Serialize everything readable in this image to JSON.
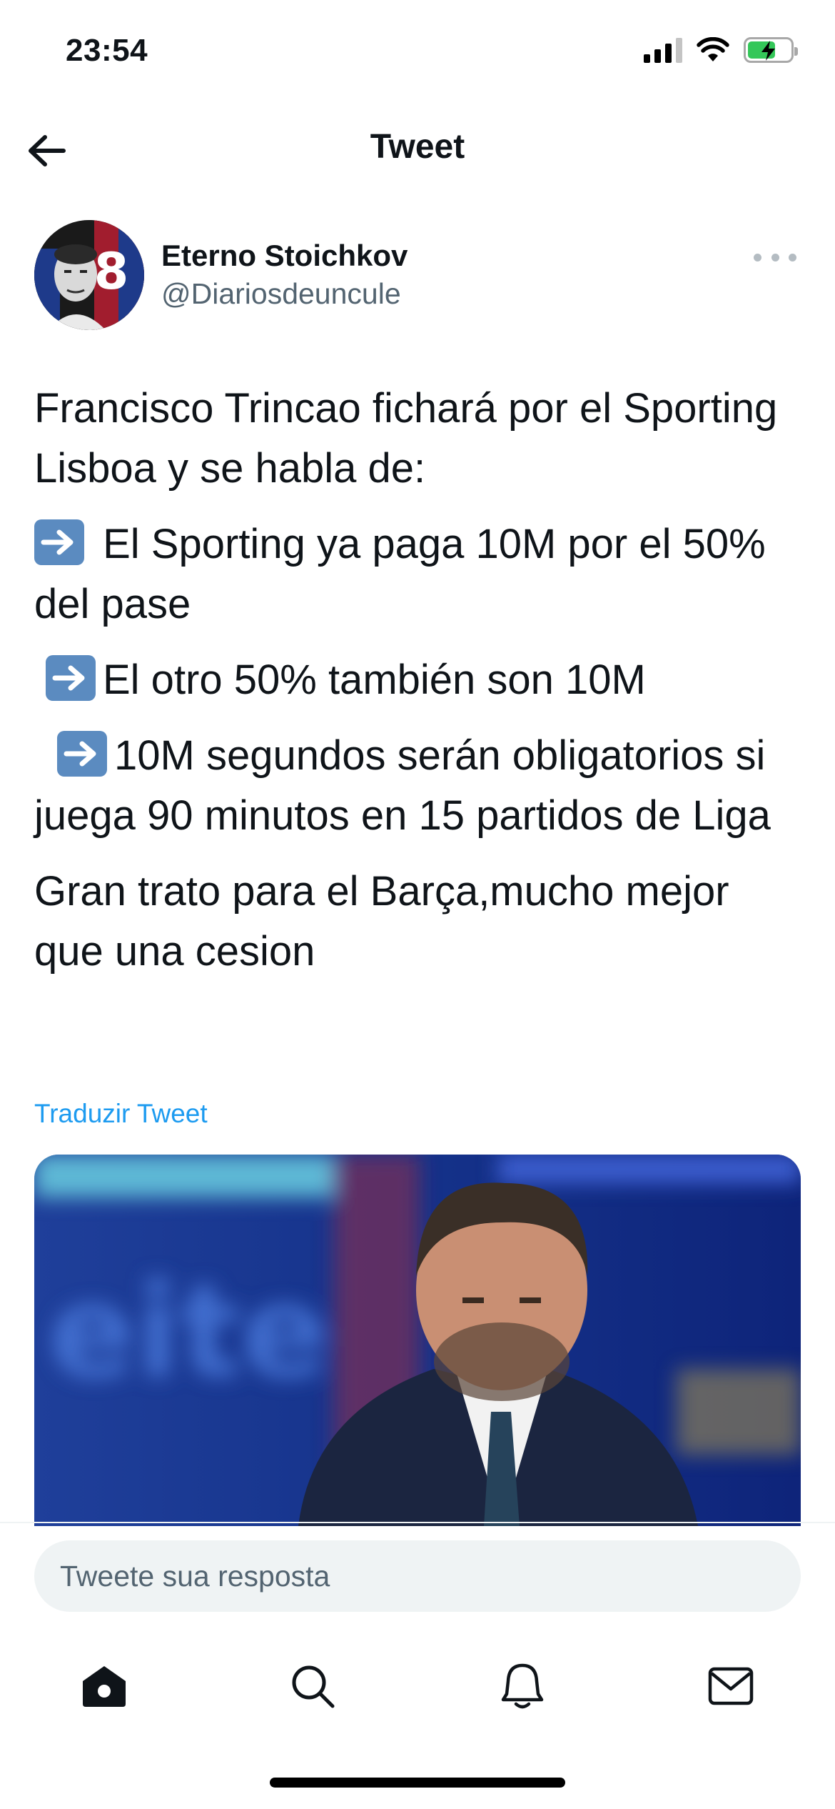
{
  "status_bar": {
    "time": "23:54",
    "icons": [
      "signal-icon",
      "wifi-icon",
      "battery-charging-icon"
    ]
  },
  "header": {
    "title": "Tweet",
    "back_icon": "arrow-left-icon"
  },
  "tweet": {
    "author_name": "Eterno Stoichkov",
    "author_handle": "@Diariosdeuncule",
    "more_icon": "more-dots-icon",
    "paragraphs": [
      "Francisco Trincao fichará por el Sporting Lisboa y se habla de:",
      " El Sporting ya paga 10M por el 50% del pase",
      "El otro 50% también son 10M",
      "10M segundos serán obligatorios si  juega 90 minutos en 15 partidos de Liga",
      "Gran trato para el Barça,mucho mejor que una cesion"
    ],
    "translate_label": "Traduzir Tweet",
    "link_color": "#1d9bf0"
  },
  "reply": {
    "placeholder": "Tweete sua resposta"
  },
  "tabbar": {
    "items": [
      "home-icon",
      "search-icon",
      "notifications-bell-icon",
      "messages-envelope-icon"
    ]
  }
}
